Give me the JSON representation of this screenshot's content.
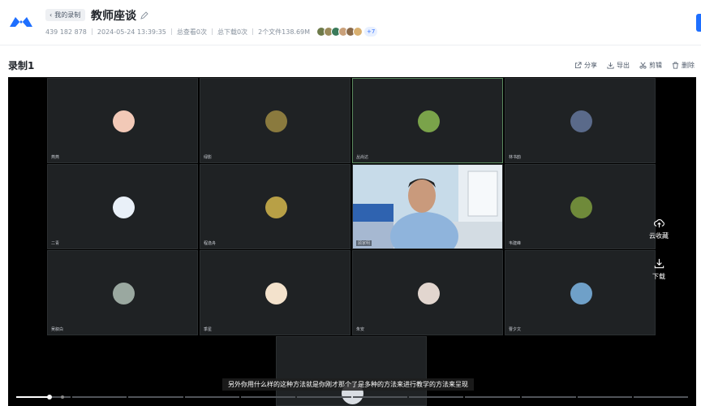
{
  "header": {
    "back_label": "我的录制",
    "title": "教师座谈",
    "meeting_id": "439 182 878",
    "datetime": "2024-05-24 13:39:35",
    "views": "总查看0次",
    "downloads": "总下载0次",
    "files": "2个文件138.69M",
    "more_viewers": "+7"
  },
  "recording": {
    "title": "录制1"
  },
  "toolbar": {
    "share": "分享",
    "export": "导出",
    "clip": "剪辑",
    "delete": "删除"
  },
  "tiles": [
    {
      "name": "燕燕",
      "color": "#f2c9b7"
    },
    {
      "name": "绿影",
      "color": "#8a7a3e"
    },
    {
      "name": "丛尚达",
      "color": "#7aa34a"
    },
    {
      "name": "林书韵",
      "color": "#5a6a8a"
    },
    {
      "name": "二青",
      "color": "#e9f0f8"
    },
    {
      "name": "程逸舟",
      "color": "#b8a046"
    },
    {
      "name": "顾家明",
      "color": ""
    },
    {
      "name": "韦建峰",
      "color": "#6f8a3a"
    },
    {
      "name": "吴叙白",
      "color": "#9aa8a0"
    },
    {
      "name": "季星",
      "color": "#f3e2cc"
    },
    {
      "name": "朱安",
      "color": "#e2d6cf"
    },
    {
      "name": "曹夕文",
      "color": "#6fa0c8"
    }
  ],
  "side": {
    "cloud_save": "云收藏",
    "download": "下载"
  },
  "subtitle": "另外你用什么样的这种方法就是你刚才那个了是多种的方法来进行教学的方法来呈现",
  "playback": {
    "progress": 0.05
  },
  "colors": {
    "accent": "#1e6fff"
  }
}
